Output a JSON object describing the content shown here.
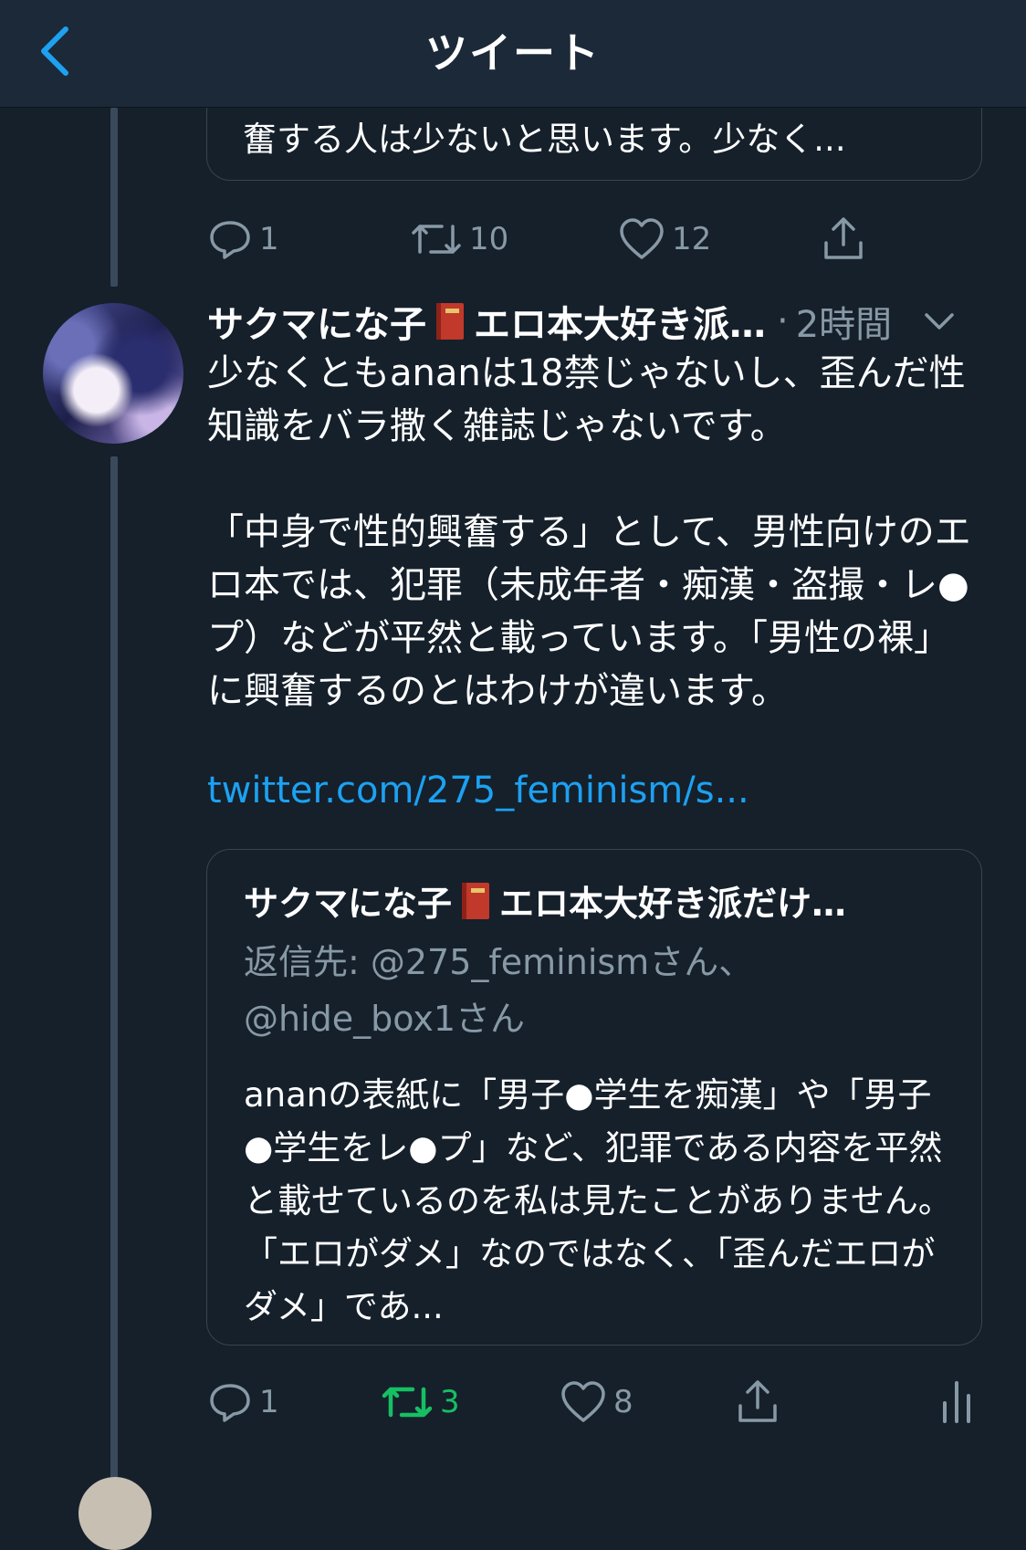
{
  "header": {
    "title": "ツイート"
  },
  "prev_tweet": {
    "quote_tail_text": "奮する人は少ないと思います。少なく...",
    "actions": {
      "replies": "1",
      "retweets": "10",
      "likes": "12"
    }
  },
  "tweet": {
    "author_name": "サクマにな子",
    "author_name_rest": "エロ本大好き派…",
    "separator": "·",
    "time": "2時間",
    "body": [
      "少なくともananは18禁じゃないし、歪んだ性知識をバラ撒く雑誌じゃないです。",
      "",
      "「中身で性的興奮する」として、男性向けのエロ本では、犯罪（未成年者・痴漢・盗撮・レ●プ）などが平然と載っています。「男性の裸」に興奮するのとはわけが違います。",
      ""
    ],
    "link": "twitter.com/275_feminism/s...",
    "quote": {
      "author_name": "サクマにな子",
      "author_name_rest": "エロ本大好き派だけ…",
      "reply_to": "返信先: @275_feminismさん、@hide_box1さん",
      "text": "ananの表紙に「男子●学生を痴漢」や「男子●学生をレ●プ」など、犯罪である内容を平然と載せているのを私は見たことがありません。「エロがダメ」なのではなく、「歪んだエロがダメ」であ..."
    },
    "actions": {
      "replies": "1",
      "retweets": "3",
      "likes": "8"
    }
  },
  "colors": {
    "background": "#15202b",
    "header": "#1c2938",
    "accent": "#1da1f2",
    "muted": "#8899a6",
    "retweet_active": "#17bf63",
    "border": "#38444d"
  },
  "icons": [
    "back-arrow-icon",
    "reply-icon",
    "retweet-icon",
    "like-icon",
    "share-icon",
    "analytics-icon",
    "book-emoji-icon",
    "chevron-down-icon"
  ]
}
